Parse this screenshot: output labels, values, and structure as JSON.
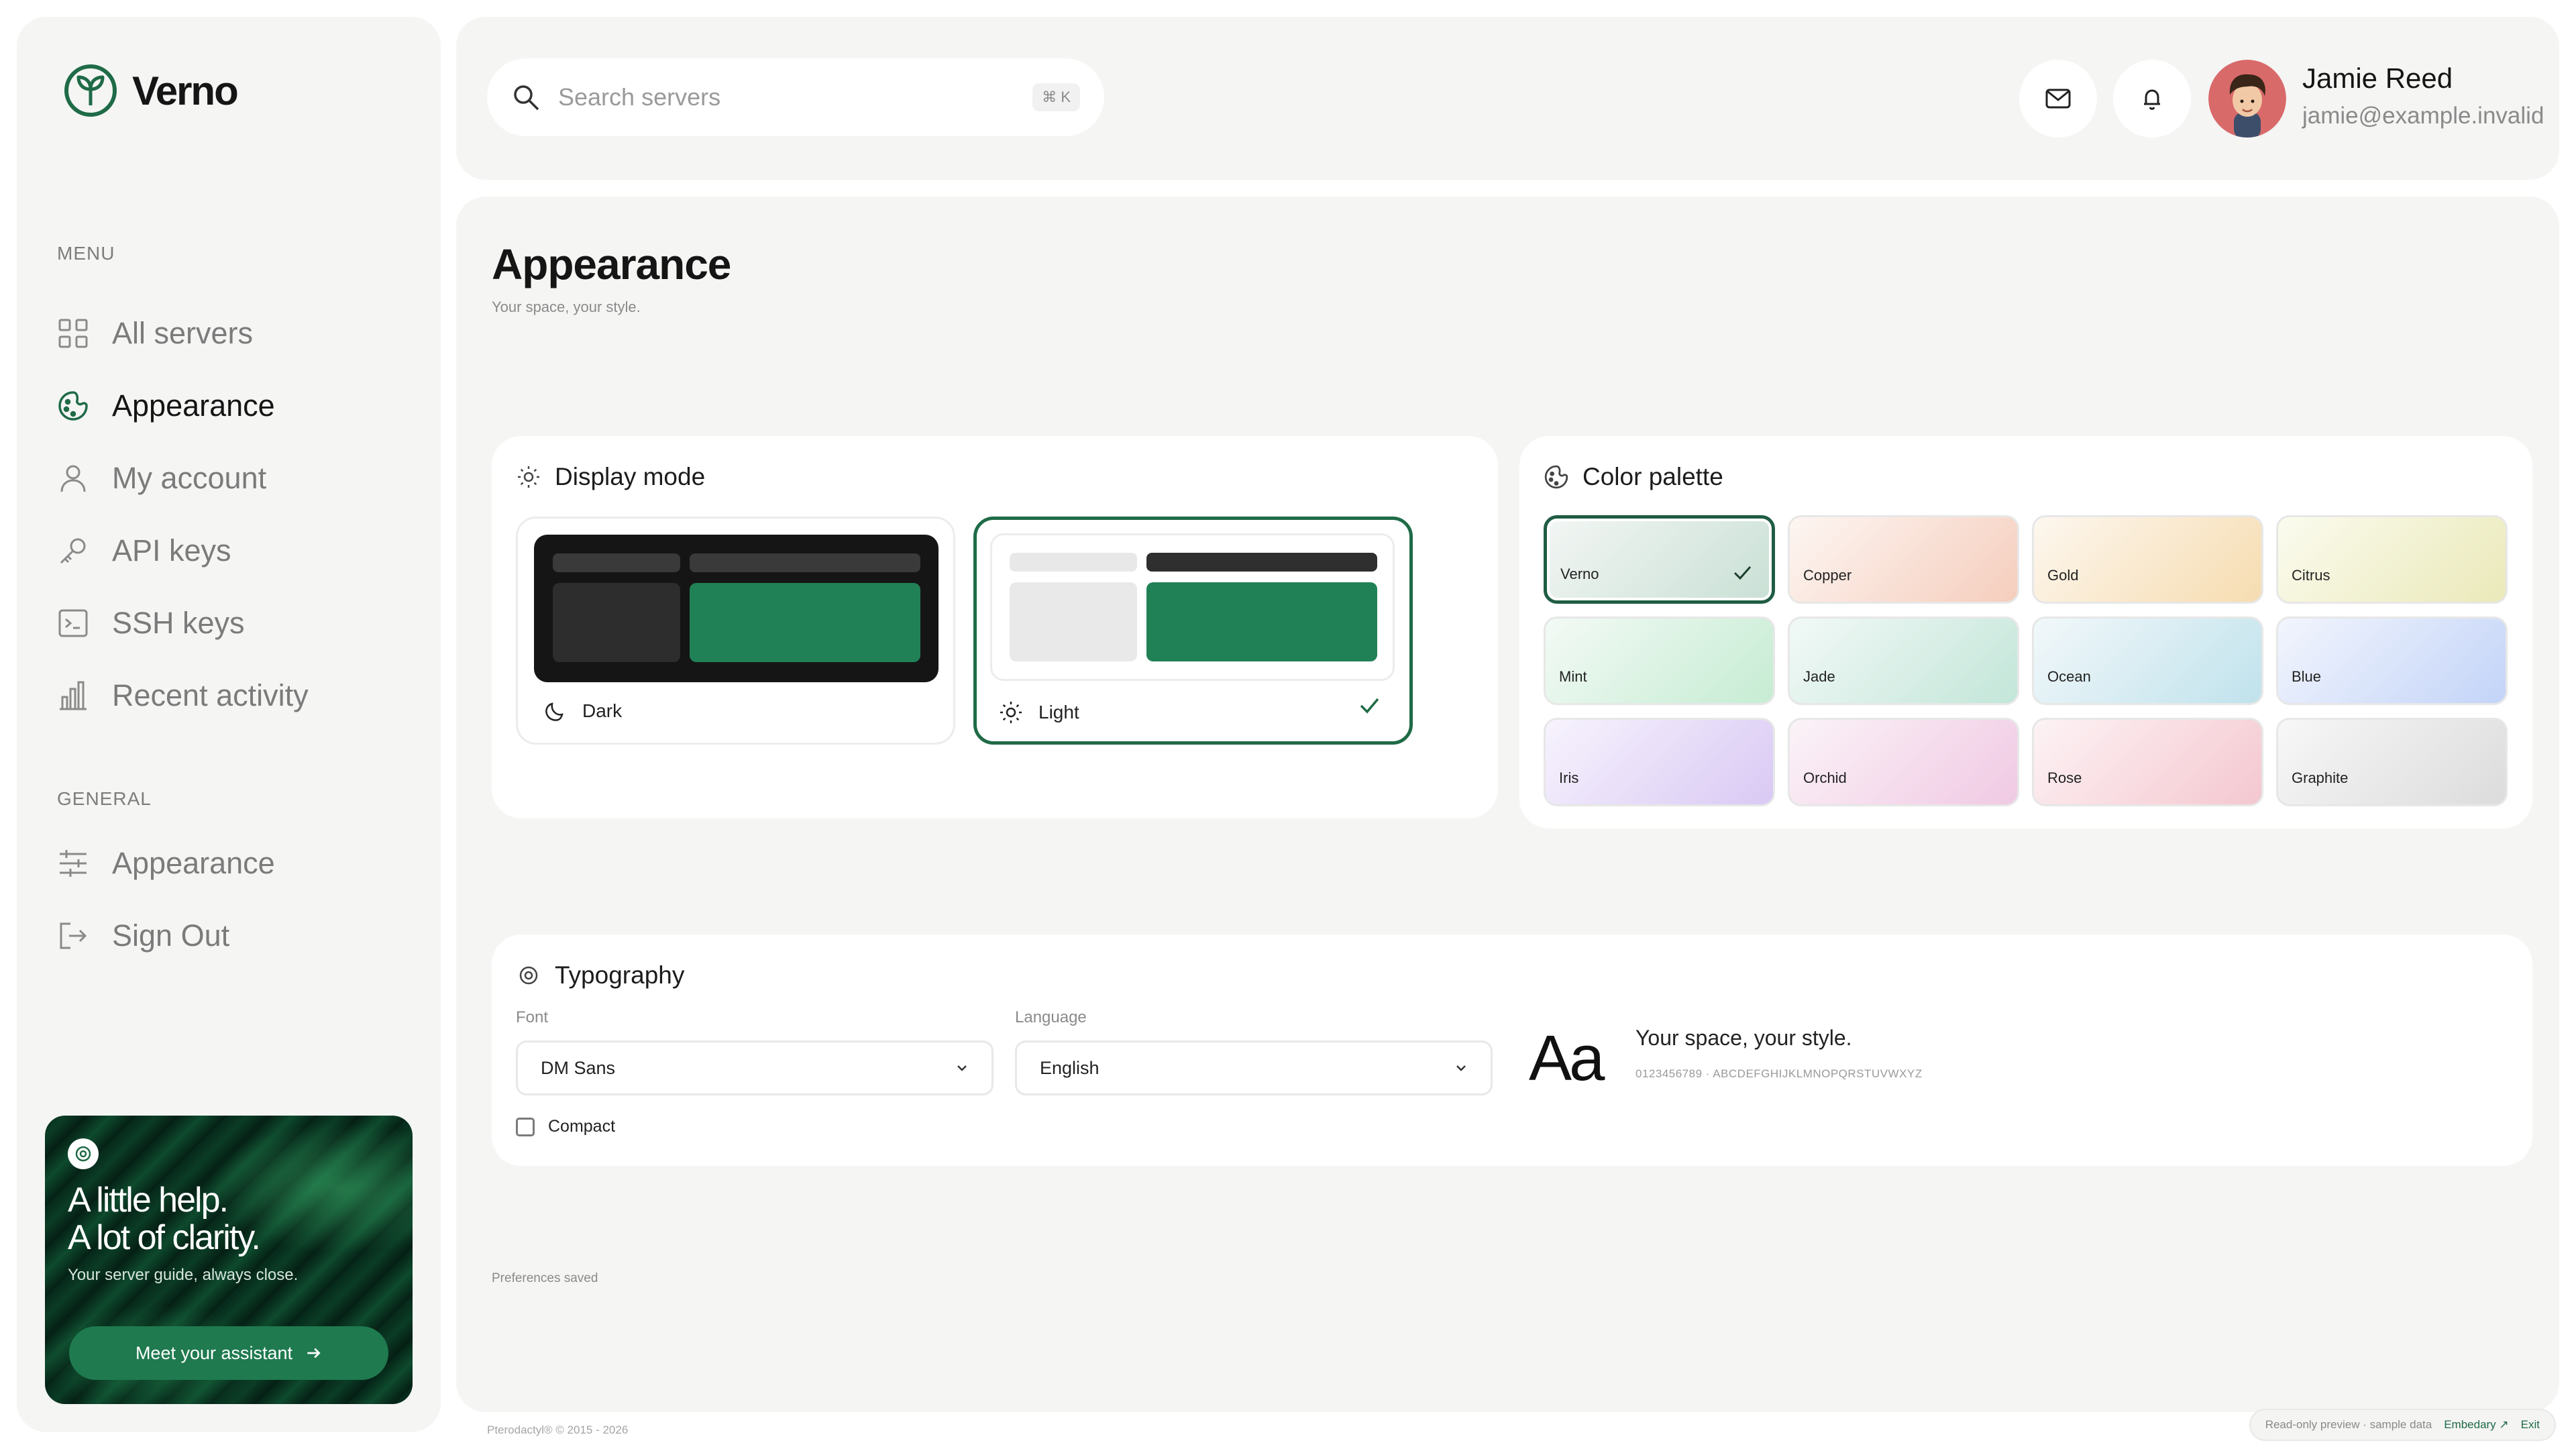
{
  "brand": {
    "name": "Verno",
    "accent": "#1f6b47"
  },
  "sidebar": {
    "menu_label": "MENU",
    "general_label": "GENERAL",
    "menu_items": [
      {
        "label": "All servers",
        "icon": "grid-icon"
      },
      {
        "label": "Appearance",
        "icon": "palette-icon",
        "active": true
      },
      {
        "label": "My account",
        "icon": "user-icon"
      },
      {
        "label": "API keys",
        "icon": "key-icon"
      },
      {
        "label": "SSH keys",
        "icon": "terminal-icon"
      },
      {
        "label": "Recent activity",
        "icon": "bar-chart-icon"
      }
    ],
    "general_items": [
      {
        "label": "Appearance",
        "icon": "sliders-icon"
      },
      {
        "label": "Sign Out",
        "icon": "sign-out-icon"
      }
    ],
    "promo": {
      "title_line1": "A little help.",
      "title_line2": "A lot of clarity.",
      "subtitle": "Your server guide, always close.",
      "button_label": "Meet your assistant"
    }
  },
  "header": {
    "search_placeholder": "Search servers",
    "search_shortcut": "⌘ K",
    "user": {
      "name": "Jamie Reed",
      "email": "jamie@example.invalid"
    }
  },
  "page": {
    "title": "Appearance",
    "subtitle": "Your space, your style.",
    "status": "Preferences saved"
  },
  "display_mode": {
    "title": "Display mode",
    "options": [
      {
        "label": "Dark",
        "selected": false
      },
      {
        "label": "Light",
        "selected": true
      }
    ]
  },
  "color_palette": {
    "title": "Color palette",
    "swatches": [
      {
        "name": "Verno",
        "selected": true,
        "from": "#f3f6f4",
        "to": "#c9e0d5"
      },
      {
        "name": "Copper",
        "from": "#fdf6f2",
        "to": "#f5cdbd"
      },
      {
        "name": "Gold",
        "from": "#fdf7ef",
        "to": "#f6dcb0"
      },
      {
        "name": "Citrus",
        "from": "#fbfbef",
        "to": "#eae9b9"
      },
      {
        "name": "Mint",
        "from": "#f3faf5",
        "to": "#c6ecd3"
      },
      {
        "name": "Jade",
        "from": "#f2f9f6",
        "to": "#c3e6d9"
      },
      {
        "name": "Ocean",
        "from": "#f2f8fa",
        "to": "#c0e2ec"
      },
      {
        "name": "Blue",
        "from": "#f2f5fd",
        "to": "#c3d4f8"
      },
      {
        "name": "Iris",
        "from": "#f7f3fd",
        "to": "#d9c9f4"
      },
      {
        "name": "Orchid",
        "from": "#fbf3f8",
        "to": "#f0c9e3"
      },
      {
        "name": "Rose",
        "from": "#fdf3f5",
        "to": "#f4c7cf"
      },
      {
        "name": "Graphite",
        "from": "#f7f7f7",
        "to": "#dcdcdc"
      }
    ]
  },
  "typography": {
    "title": "Typography",
    "font_label": "Font",
    "font_value": "DM Sans",
    "language_label": "Language",
    "language_value": "English",
    "compact_label": "Compact",
    "compact_checked": false,
    "preview_glyph": "Aa",
    "preview_sample": "Your space, your style.",
    "preview_chars": "0123456789 · ABCDEFGHIJKLMNOPQRSTUVWXYZ"
  },
  "footer": {
    "copyright": "Pterodactyl® © 2015 - 2026",
    "preview_note": "Read-only preview · sample data",
    "embedary_label": "Embedary ↗",
    "exit_label": "Exit"
  }
}
